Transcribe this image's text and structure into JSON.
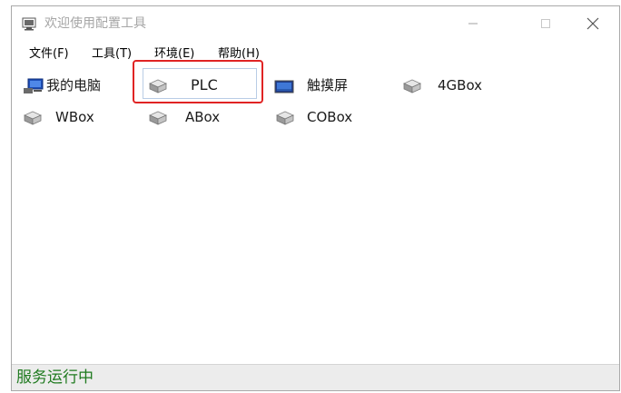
{
  "window": {
    "title": "欢迎使用配置工具",
    "controls": {
      "minimize": "minimize",
      "maximize": "maximize",
      "close": "close"
    }
  },
  "menu": [
    {
      "label": "文件(F)"
    },
    {
      "label": "工具(T)"
    },
    {
      "label": "环境(E)"
    },
    {
      "label": "帮助(H)"
    }
  ],
  "items": [
    {
      "label": "我的电脑",
      "icon": "computer-icon"
    },
    {
      "label": "PLC",
      "icon": "device-icon",
      "selected": true
    },
    {
      "label": "触摸屏",
      "icon": "touchscreen-icon"
    },
    {
      "label": "4GBox",
      "icon": "device-icon"
    },
    {
      "label": "WBox",
      "icon": "device-icon"
    },
    {
      "label": "ABox",
      "icon": "device-icon"
    },
    {
      "label": "COBox",
      "icon": "device-icon"
    }
  ],
  "status": {
    "text": "服务运行中",
    "color": "#1f7a1f"
  },
  "highlight_color": "#e02424"
}
